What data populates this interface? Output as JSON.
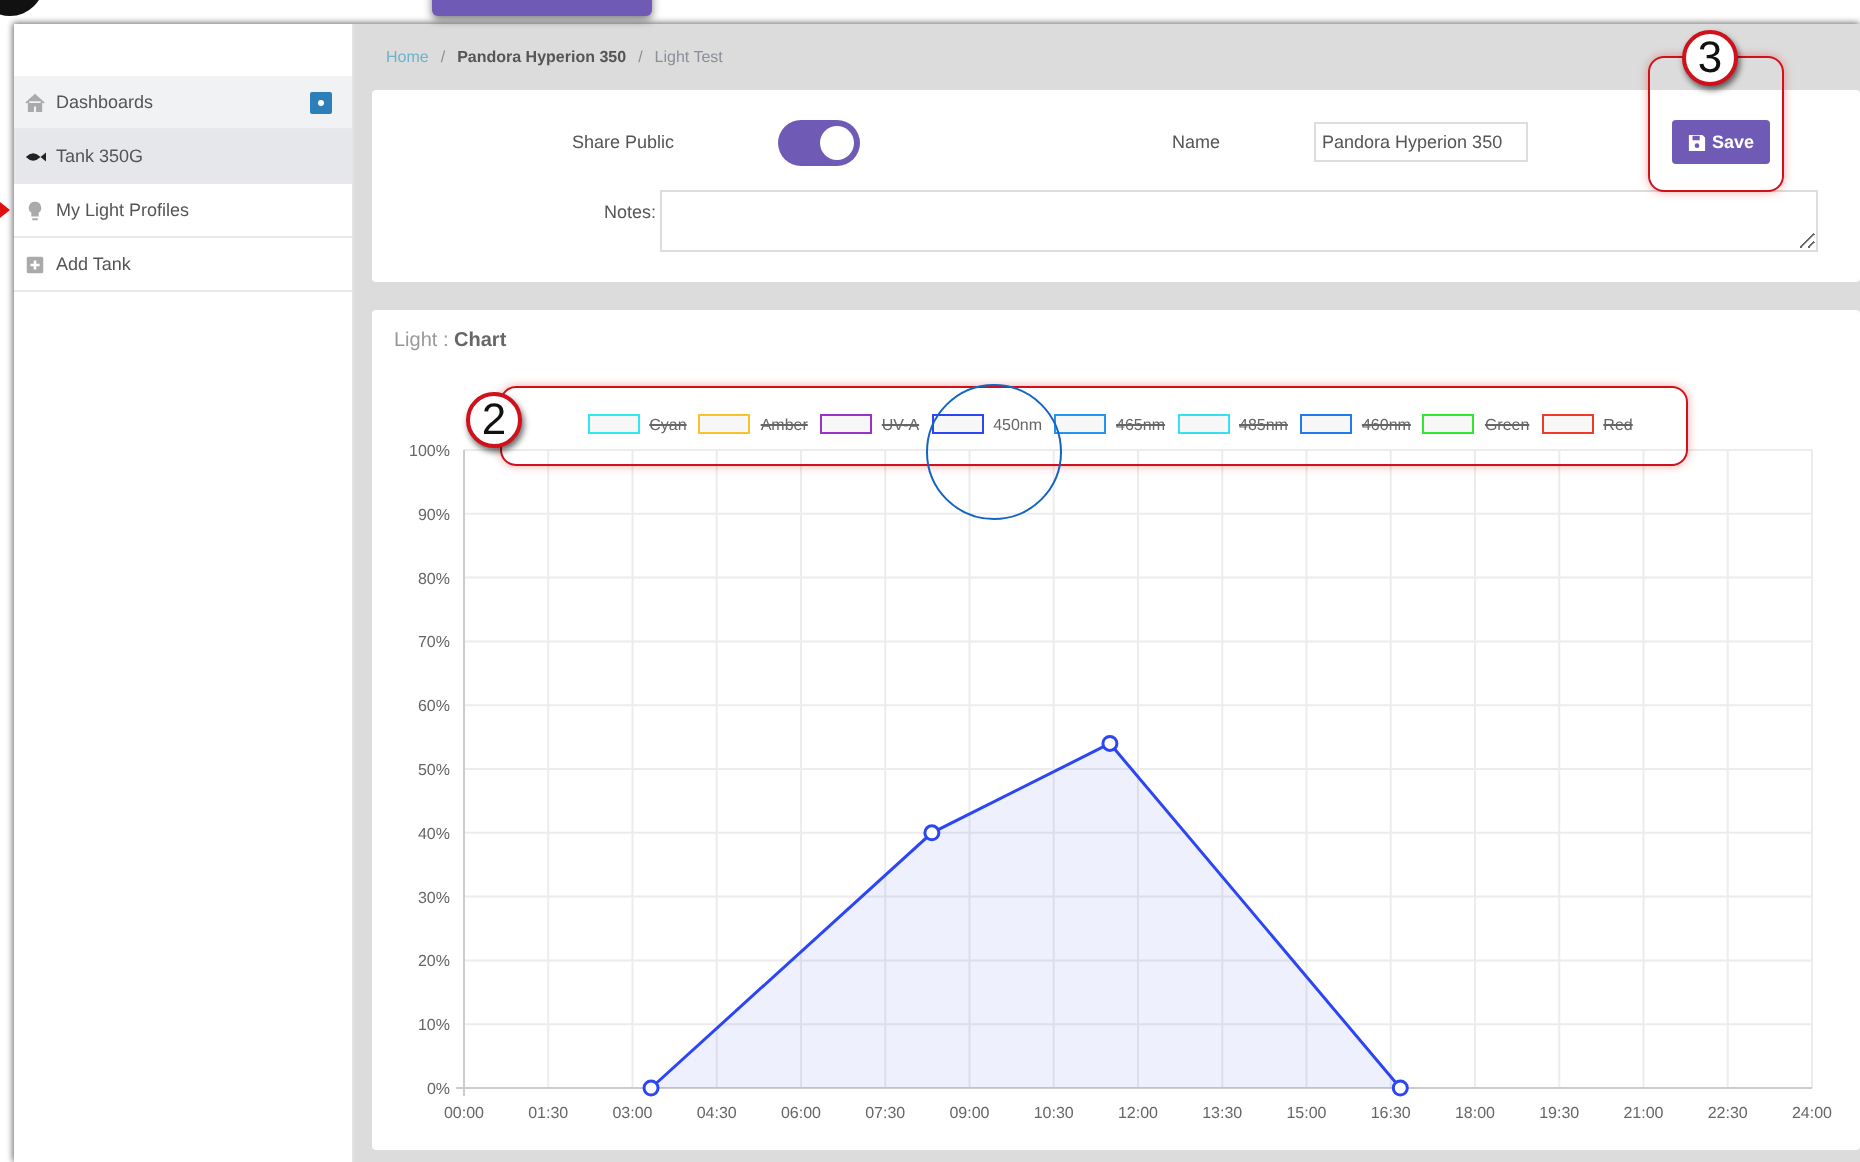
{
  "sidebar": {
    "items": [
      {
        "label": "Dashboards",
        "badge": true,
        "selected": false
      },
      {
        "label": "Tank 350G",
        "badge": false,
        "selected": true
      },
      {
        "label": "My Light Profiles",
        "badge": false,
        "selected": false
      },
      {
        "label": "Add Tank",
        "badge": false,
        "selected": false
      }
    ]
  },
  "breadcrumb": [
    {
      "label": "Home",
      "kind": "link"
    },
    {
      "label": "/",
      "kind": "sep"
    },
    {
      "label": "Pandora Hyperion 350",
      "kind": "bold"
    },
    {
      "label": "/",
      "kind": "sep"
    },
    {
      "label": "Light Test",
      "kind": "current"
    }
  ],
  "form": {
    "share_label": "Share Public",
    "share_on": true,
    "name_label": "Name",
    "name_value": "Pandora Hyperion 350",
    "save_label": "Save",
    "notes_label": "Notes:"
  },
  "chart": {
    "title": "Light : **Chart**",
    "chart_data": {
      "type": "line",
      "grid": true,
      "x": [
        3.33,
        8.33,
        11.5,
        16.67
      ],
      "series": [
        {
          "name": "Cyan",
          "color": "#2ee8f4",
          "values": [
            null,
            null,
            null,
            null
          ]
        },
        {
          "name": "Amber",
          "color": "#f8c22a",
          "values": [
            null,
            null,
            null,
            null
          ]
        },
        {
          "name": "UV-A",
          "color": "#9b32c8",
          "values": [
            null,
            null,
            null,
            null
          ]
        },
        {
          "name": "450nm",
          "color": "#2c46f5",
          "marker": "circle",
          "values": [
            0,
            40,
            54,
            0
          ]
        },
        {
          "name": "465nm",
          "color": "#2196f3",
          "values": [
            null,
            null,
            null,
            null
          ]
        },
        {
          "name": "485nm",
          "color": "#35e0f0",
          "values": [
            null,
            null,
            null,
            null
          ]
        },
        {
          "name": "460nm",
          "color": "#1e7cf0",
          "values": [
            null,
            null,
            null,
            null
          ]
        },
        {
          "name": "Green",
          "color": "#30e830",
          "values": [
            null,
            null,
            null,
            null
          ]
        },
        {
          "name": "Red",
          "color": "#f03a2a",
          "values": [
            null,
            null,
            null,
            null
          ]
        }
      ],
      "xlim": [
        0,
        24
      ],
      "ylim": [
        0,
        100
      ],
      "xticks": [
        {
          "value": 0,
          "label": "00:00"
        },
        {
          "value": 1.5,
          "label": "01:30"
        },
        {
          "value": 3,
          "label": "03:00"
        },
        {
          "value": 4.5,
          "label": "04:30"
        },
        {
          "value": 6,
          "label": "06:00"
        },
        {
          "value": 7.5,
          "label": "07:30"
        },
        {
          "value": 9,
          "label": "09:00"
        },
        {
          "value": 10.5,
          "label": "10:30"
        },
        {
          "value": 12,
          "label": "12:00"
        },
        {
          "value": 13.5,
          "label": "13:30"
        },
        {
          "value": 15,
          "label": "15:00"
        },
        {
          "value": 16.5,
          "label": "16:30"
        },
        {
          "value": 18,
          "label": "18:00"
        },
        {
          "value": 19.5,
          "label": "19:30"
        },
        {
          "value": 21,
          "label": "21:00"
        },
        {
          "value": 22.5,
          "label": "22:30"
        },
        {
          "value": 24,
          "label": "24:00"
        }
      ],
      "yticks": [
        {
          "value": 0,
          "label": "0%"
        },
        {
          "value": 10,
          "label": "10%"
        },
        {
          "value": 20,
          "label": "20%"
        },
        {
          "value": 30,
          "label": "30%"
        },
        {
          "value": 40,
          "label": "40%"
        },
        {
          "value": 50,
          "label": "50%"
        },
        {
          "value": 60,
          "label": "60%"
        },
        {
          "value": 70,
          "label": "70%"
        },
        {
          "value": 80,
          "label": "80%"
        },
        {
          "value": 90,
          "label": "90%"
        },
        {
          "value": 100,
          "label": "100%"
        }
      ]
    }
  },
  "annotations": [
    {
      "kind": "callout",
      "label": "2"
    },
    {
      "kind": "callout",
      "label": "3"
    },
    {
      "kind": "box"
    },
    {
      "kind": "box"
    },
    {
      "kind": "circle"
    },
    {
      "kind": "arrow"
    }
  ]
}
